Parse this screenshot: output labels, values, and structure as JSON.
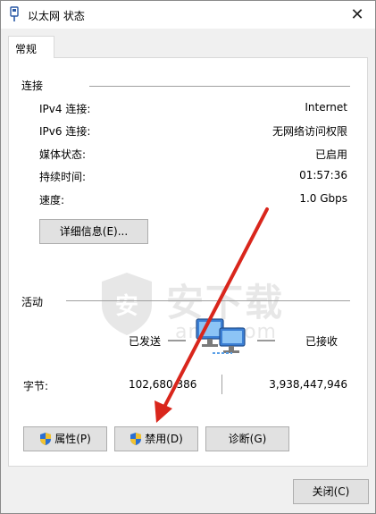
{
  "window": {
    "title": "以太网 状态",
    "close_symbol": "✕"
  },
  "tab": {
    "label": "常规"
  },
  "connection": {
    "section_label": "连接",
    "rows": [
      {
        "label": "IPv4 连接:",
        "value": "Internet"
      },
      {
        "label": "IPv6 连接:",
        "value": "无网络访问权限"
      },
      {
        "label": "媒体状态:",
        "value": "已启用"
      },
      {
        "label": "持续时间:",
        "value": "01:57:36"
      },
      {
        "label": "速度:",
        "value": "1.0 Gbps"
      }
    ],
    "details_button": "详细信息(E)..."
  },
  "activity": {
    "section_label": "活动",
    "sent_label": "已发送",
    "received_label": "已接收",
    "bytes_label": "字节:",
    "bytes_sent": "102,680,386",
    "bytes_received": "3,938,447,946",
    "network_icon": "network-computers-icon"
  },
  "buttons": {
    "properties": "属性(P)",
    "disable": "禁用(D)",
    "diagnose": "诊断(G)",
    "close": "关闭(C)"
  },
  "watermark": {
    "logo": "安",
    "text_cn": "安下载",
    "text_en": "anxz.com"
  },
  "colors": {
    "arrow": "#d9261c",
    "shield_blue": "#2a6fd3",
    "shield_yellow": "#f2c230"
  }
}
